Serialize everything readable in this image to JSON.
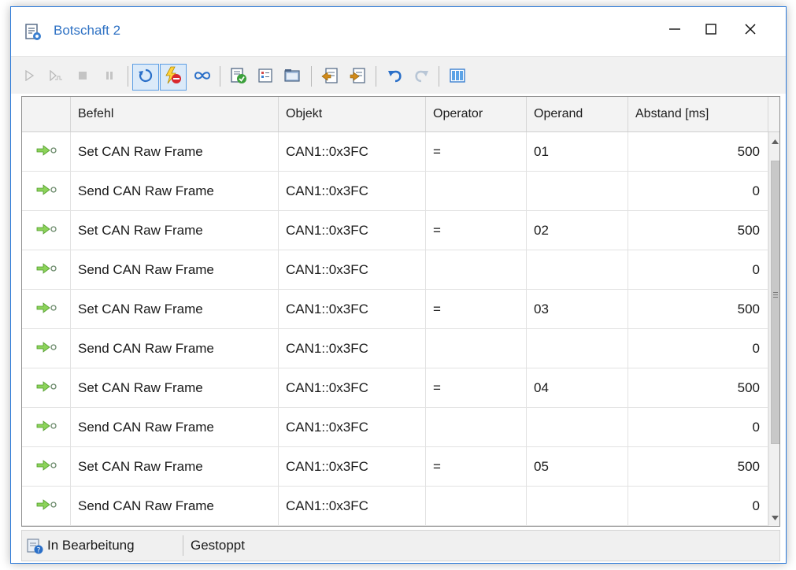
{
  "window": {
    "title": "Botschaft 2",
    "controls": [
      "minimize-icon",
      "maximize-icon",
      "close-icon"
    ]
  },
  "toolbar": {
    "buttons": [
      {
        "icon": "play-icon",
        "enabled": false
      },
      {
        "icon": "step-icon",
        "enabled": false
      },
      {
        "icon": "stop-icon",
        "enabled": false
      },
      {
        "icon": "pause-icon",
        "enabled": false
      },
      {
        "icon": "repeat-icon",
        "active": true
      },
      {
        "icon": "break-on-error-icon",
        "active": true
      },
      {
        "icon": "infinite-loop-icon"
      },
      {
        "icon": "check-message-icon"
      },
      {
        "icon": "list-icon"
      },
      {
        "icon": "folder-icon"
      },
      {
        "icon": "import-icon"
      },
      {
        "icon": "export-icon"
      },
      {
        "icon": "undo-icon"
      },
      {
        "icon": "redo-icon",
        "enabled": false
      },
      {
        "icon": "columns-icon"
      }
    ]
  },
  "grid": {
    "columns": [
      "",
      "Befehl",
      "Objekt",
      "Operator",
      "Operand",
      "Abstand [ms]"
    ],
    "rows": [
      {
        "befehl": "Set CAN Raw Frame",
        "objekt": "CAN1::0x3FC",
        "operator": "=",
        "operand": "01",
        "abstand": "500"
      },
      {
        "befehl": "Send CAN Raw Frame",
        "objekt": "CAN1::0x3FC",
        "operator": "",
        "operand": "",
        "abstand": "0"
      },
      {
        "befehl": "Set CAN Raw Frame",
        "objekt": "CAN1::0x3FC",
        "operator": "=",
        "operand": "02",
        "abstand": "500"
      },
      {
        "befehl": "Send CAN Raw Frame",
        "objekt": "CAN1::0x3FC",
        "operator": "",
        "operand": "",
        "abstand": "0"
      },
      {
        "befehl": "Set CAN Raw Frame",
        "objekt": "CAN1::0x3FC",
        "operator": "=",
        "operand": "03",
        "abstand": "500"
      },
      {
        "befehl": "Send CAN Raw Frame",
        "objekt": "CAN1::0x3FC",
        "operator": "",
        "operand": "",
        "abstand": "0"
      },
      {
        "befehl": "Set CAN Raw Frame",
        "objekt": "CAN1::0x3FC",
        "operator": "=",
        "operand": "04",
        "abstand": "500"
      },
      {
        "befehl": "Send CAN Raw Frame",
        "objekt": "CAN1::0x3FC",
        "operator": "",
        "operand": "",
        "abstand": "0"
      },
      {
        "befehl": "Set CAN Raw Frame",
        "objekt": "CAN1::0x3FC",
        "operator": "=",
        "operand": "05",
        "abstand": "500"
      },
      {
        "befehl": "Send CAN Raw Frame",
        "objekt": "CAN1::0x3FC",
        "operator": "",
        "operand": "",
        "abstand": "0"
      }
    ],
    "row_icon": "command-arrow-icon"
  },
  "statusbar": {
    "state": "In Bearbeitung",
    "run_state": "Gestoppt"
  },
  "colors": {
    "accent": "#2b79d9",
    "title_text": "#2f72c4",
    "row_arrow": "#6bbf3f"
  }
}
